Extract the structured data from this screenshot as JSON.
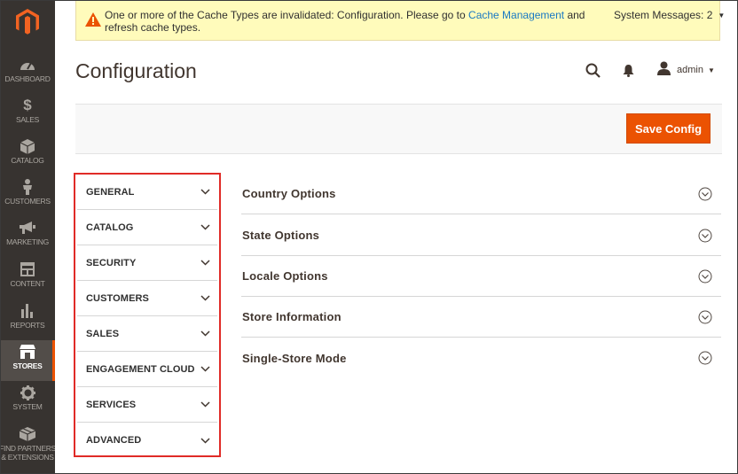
{
  "message": {
    "text_before": "One or more of the Cache Types are invalidated: Configuration. Please go to",
    "link": "Cache Management",
    "text_after": "and refresh cache types.",
    "system_messages": "System Messages: 2"
  },
  "sidebar": {
    "items": [
      {
        "label": "DASHBOARD",
        "icon": "dashboard-icon"
      },
      {
        "label": "SALES",
        "icon": "dollar-icon"
      },
      {
        "label": "CATALOG",
        "icon": "cube-icon"
      },
      {
        "label": "CUSTOMERS",
        "icon": "person-icon"
      },
      {
        "label": "MARKETING",
        "icon": "megaphone-icon"
      },
      {
        "label": "CONTENT",
        "icon": "layout-icon"
      },
      {
        "label": "REPORTS",
        "icon": "bar-chart-icon"
      },
      {
        "label": "STORES",
        "icon": "store-icon"
      },
      {
        "label": "SYSTEM",
        "icon": "gear-icon"
      },
      {
        "label": "FIND PARTNERS",
        "label2": "& EXTENSIONS",
        "icon": "boxes-icon"
      }
    ],
    "active": "STORES"
  },
  "header": {
    "title": "Configuration",
    "user": "admin"
  },
  "toolbar": {
    "save_label": "Save Config"
  },
  "tabs": [
    {
      "label": "GENERAL"
    },
    {
      "label": "CATALOG"
    },
    {
      "label": "SECURITY"
    },
    {
      "label": "CUSTOMERS"
    },
    {
      "label": "SALES"
    },
    {
      "label": "ENGAGEMENT CLOUD"
    },
    {
      "label": "SERVICES"
    },
    {
      "label": "ADVANCED"
    }
  ],
  "sections": [
    {
      "label": "Country Options"
    },
    {
      "label": "State Options"
    },
    {
      "label": "Locale Options"
    },
    {
      "label": "Store Information"
    },
    {
      "label": "Single-Store Mode"
    }
  ],
  "colors": {
    "accent": "#eb5202",
    "sidebar_bg": "#373330",
    "highlight_border": "#e02b27",
    "message_bg": "#fffbbb",
    "link": "#1979c3"
  }
}
